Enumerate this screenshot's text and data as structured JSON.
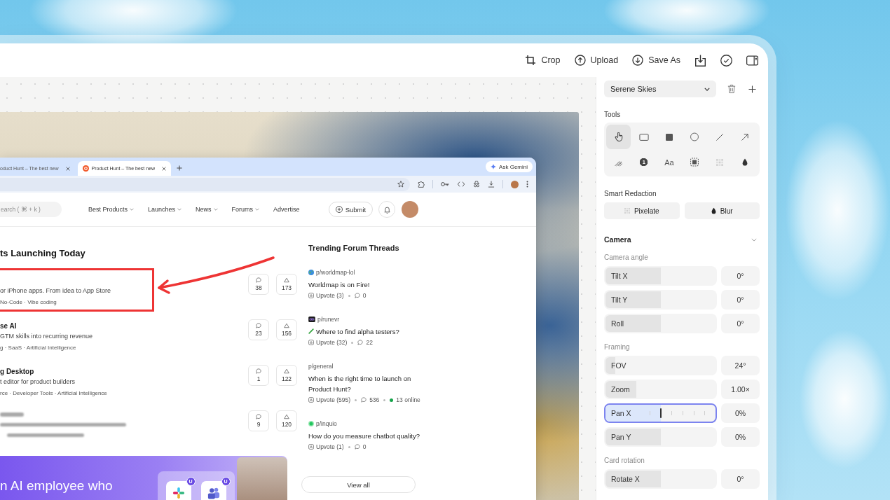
{
  "toolbar": {
    "actions": [
      {
        "kind": "crop",
        "label": "Crop"
      },
      {
        "kind": "upload",
        "label": "Upload"
      },
      {
        "kind": "save",
        "label": "Save As"
      }
    ]
  },
  "browser": {
    "tabs": [
      {
        "title": "oduct Hunt – The best new",
        "selected": false,
        "favicon": false
      },
      {
        "title": "Product Hunt – The best new",
        "selected": true,
        "favicon": true
      }
    ],
    "ask_button": "Ask Gemini",
    "page": {
      "search": {
        "placeholder": "earch ( ⌘ + k )"
      },
      "nav": [
        {
          "label": "Best Products",
          "dropdown": true
        },
        {
          "label": "Launches",
          "dropdown": true
        },
        {
          "label": "News",
          "dropdown": true
        },
        {
          "label": "Forums",
          "dropdown": true
        },
        {
          "label": "Advertise",
          "dropdown": false
        }
      ],
      "submit": "Submit",
      "launches": {
        "heading": "ts Launching Today",
        "products": [
          {
            "kind": "listed",
            "tagline": "or iPhone apps. From idea to App Store",
            "tags": "No-Code · Vibe coding",
            "comments": "38",
            "upvotes": "173",
            "annotated": true
          },
          {
            "kind": "listed",
            "name": "se AI",
            "tagline": "GTM skills into recurring revenue",
            "tags": "g · SaaS · Artificial Intelligence",
            "comments": "23",
            "upvotes": "156",
            "annotated": false
          },
          {
            "kind": "listed",
            "name": "g Desktop",
            "tagline": "t editor for product builders",
            "tags": "rce · Developer Tools · Artificial Intelligence",
            "comments": "1",
            "upvotes": "122",
            "annotated": false
          },
          {
            "kind": "blurred",
            "comments": "9",
            "upvotes": "120",
            "annotated": false
          }
        ]
      },
      "banner": {
        "headline": "n AI employee who",
        "badges": [
          "U",
          "U"
        ]
      },
      "forum": {
        "heading": "Trending Forum Threads",
        "threads": [
          {
            "kind": "globe",
            "community": "p/worldmap-lol",
            "title": "Worldmap is on Fire!",
            "title_icon": false,
            "upvotes": "Upvote (3)",
            "comments": "0"
          },
          {
            "kind": "logo",
            "community": "p/runevr",
            "title": "Where to find alpha testers?",
            "title_icon": true,
            "upvotes": "Upvote (32)",
            "comments": "22"
          },
          {
            "kind": "plain",
            "community": "p/general",
            "title": "When is the right time to launch on Product Hunt?",
            "title_icon": false,
            "upvotes": "Upvote (595)",
            "comments": "536",
            "online": "13 online"
          },
          {
            "kind": "dot",
            "community": "p/inquio",
            "title": "How do you measure chatbot quality?",
            "title_icon": false,
            "upvotes": "Upvote (1)",
            "comments": "0"
          }
        ],
        "view_all": "View all"
      }
    }
  },
  "panel": {
    "preset": "Serene Skies",
    "tools_label": "Tools",
    "tools": [
      {
        "kind": "hand",
        "selected": true
      },
      {
        "kind": "rectangle",
        "selected": false
      },
      {
        "kind": "filled-rectangle",
        "selected": false
      },
      {
        "kind": "ellipse",
        "selected": false
      },
      {
        "kind": "line",
        "selected": false
      },
      {
        "kind": "arrow",
        "selected": false
      },
      {
        "kind": "pen",
        "selected": false
      },
      {
        "kind": "counter",
        "glyph": "1",
        "selected": false
      },
      {
        "kind": "text",
        "glyph": "Aa",
        "selected": false
      },
      {
        "kind": "highlight",
        "selected": false
      },
      {
        "kind": "pixelate",
        "selected": false
      },
      {
        "kind": "blur",
        "selected": false
      }
    ],
    "redaction": {
      "label": "Smart Redaction",
      "buttons": [
        {
          "kind": "pixelate",
          "label": "Pixelate"
        },
        {
          "kind": "blur",
          "label": "Blur"
        }
      ]
    },
    "camera": {
      "title": "Camera",
      "expanded": true,
      "groups": [
        {
          "label": "Camera angle",
          "sliders": [
            {
              "label": "Tilt X",
              "level": 0.5,
              "value": "0°",
              "focused": false
            },
            {
              "label": "Tilt Y",
              "level": 0.5,
              "value": "0°",
              "focused": false
            },
            {
              "label": "Roll",
              "level": 0.5,
              "value": "0°",
              "focused": false
            }
          ]
        },
        {
          "label": "Framing",
          "sliders": [
            {
              "label": "FOV",
              "level": 0.09,
              "value": "24°",
              "focused": false
            },
            {
              "label": "Zoom",
              "level": 0.28,
              "value": "1.00×",
              "focused": false
            },
            {
              "label": "Pan X",
              "level": 0.5,
              "value": "0%",
              "focused": true
            },
            {
              "label": "Pan Y",
              "level": 0.5,
              "value": "0%",
              "focused": false
            }
          ]
        },
        {
          "label": "Card rotation",
          "sliders": [
            {
              "label": "Rotate X",
              "level": 0.5,
              "value": "0°",
              "focused": false
            }
          ]
        }
      ]
    }
  }
}
